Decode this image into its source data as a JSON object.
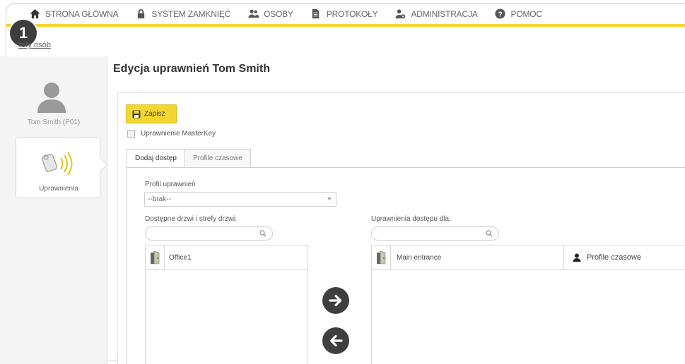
{
  "nav": {
    "items": [
      {
        "label": "STRONA GŁÓWNA",
        "icon": "home-icon"
      },
      {
        "label": "SYSTEM ZAMKNIĘĆ",
        "icon": "lock-icon"
      },
      {
        "label": "OSOBY",
        "icon": "people-icon"
      },
      {
        "label": "PROTOKOŁY",
        "icon": "document-icon"
      },
      {
        "label": "ADMINISTRACJA",
        "icon": "admin-icon"
      },
      {
        "label": "POMOC",
        "icon": "help-icon"
      }
    ],
    "accent": "#f3d630"
  },
  "badge": "1",
  "back_link": "listy osób",
  "sidebar": {
    "person_name": "Tom Smith (P01)",
    "tile_label": "Uprawnienia"
  },
  "page_title": "Edycja uprawnień Tom Smith",
  "toolbar": {
    "save_label": "Zapisz"
  },
  "masterkey_label": "Uprawnienie MasterKey",
  "tabs": [
    {
      "label": "Dodaj dostęp",
      "active": true
    },
    {
      "label": "Profile czasowe",
      "active": false
    }
  ],
  "profile": {
    "label": "Profil uprawnień",
    "value": "--brak--"
  },
  "available": {
    "label": "Dostępne drzwi i strefy drzwi:",
    "search_value": "",
    "items": [
      "Office1"
    ]
  },
  "assigned": {
    "label": "Uprawnienia dostępu dla:",
    "search_value": "",
    "items": [
      "Main entrance"
    ],
    "column_profile": "Profile czasowe"
  }
}
